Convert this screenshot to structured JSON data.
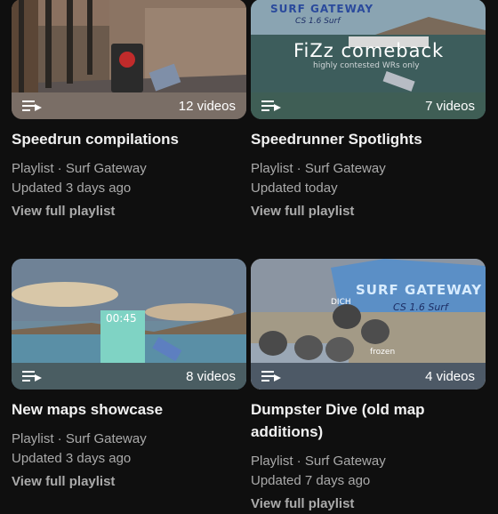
{
  "playlists": [
    {
      "title": "Speedrun compilations",
      "type_channel": "Playlist · Surf Gateway",
      "updated": "Updated 3 days ago",
      "view_link": "View full playlist",
      "video_count": "12 videos",
      "overlay_color": "#7a6e66",
      "thumb_text": []
    },
    {
      "title": "Speedrunner Spotlights",
      "type_channel": "Playlist · Surf Gateway",
      "updated": "Updated today",
      "view_link": "View full playlist",
      "video_count": "7 videos",
      "overlay_color": "#3f5e55",
      "thumb_text": [
        "SURF GATEWAY",
        "CS 1.6 Surf",
        "FiZz comeback",
        "highly contested WRs only"
      ]
    },
    {
      "title": "New maps showcase",
      "type_channel": "Playlist · Surf Gateway",
      "updated": "Updated 3 days ago",
      "view_link": "View full playlist",
      "video_count": "8 videos",
      "overlay_color": "#4a5d62",
      "thumb_text": [
        "00:45"
      ]
    },
    {
      "title": "Dumpster Dive (old map additions)",
      "type_channel": "Playlist · Surf Gateway",
      "updated": "Updated 7 days ago",
      "view_link": "View full playlist",
      "video_count": "4 videos",
      "overlay_color": "#4d5966",
      "thumb_text": [
        "SURF GATEWAY",
        "CS 1.6 Surf",
        "DICH",
        "frozen"
      ]
    }
  ]
}
